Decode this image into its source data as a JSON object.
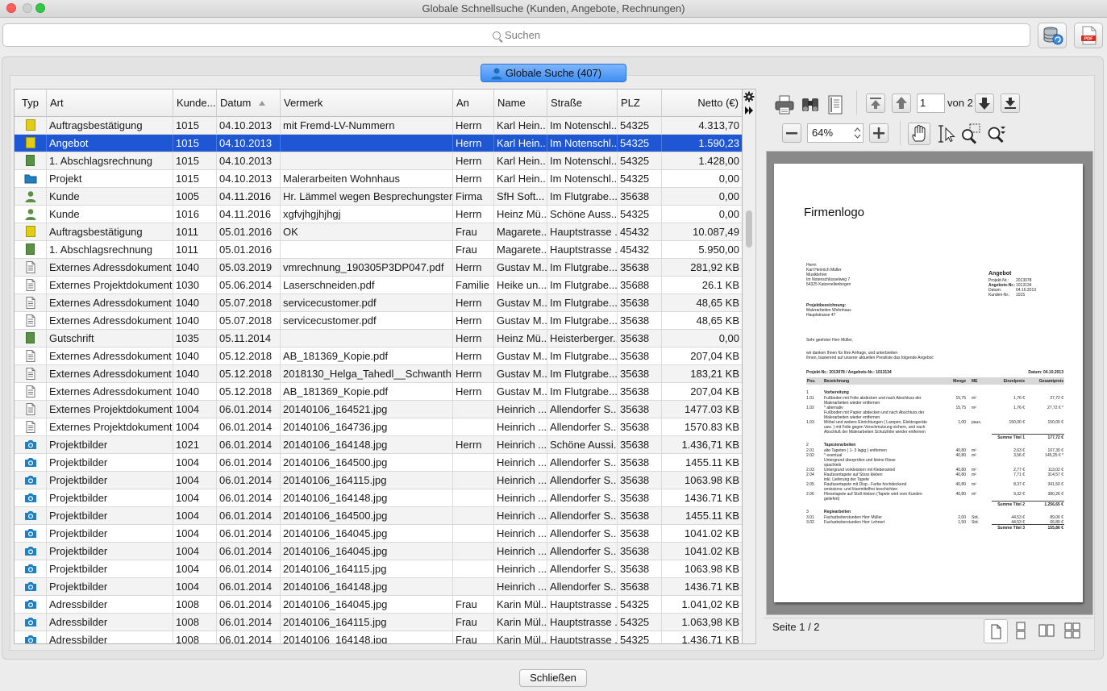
{
  "window": {
    "title": "Globale Schnellsuche (Kunden, Angebote, Rechnungen)"
  },
  "search": {
    "placeholder": "Suchen"
  },
  "toolbar": {
    "database_icon": "database-refresh-icon",
    "pdf_icon": "pdf-export-icon"
  },
  "group": {
    "label": "Globale Suche (407)"
  },
  "table": {
    "columns": [
      {
        "key": "typ",
        "label": "Typ"
      },
      {
        "key": "art",
        "label": "Art"
      },
      {
        "key": "kunde",
        "label": "Kunde..."
      },
      {
        "key": "datum",
        "label": "Datum"
      },
      {
        "key": "vermerk",
        "label": "Vermerk"
      },
      {
        "key": "an",
        "label": "An"
      },
      {
        "key": "name",
        "label": "Name"
      },
      {
        "key": "strasse",
        "label": "Straße"
      },
      {
        "key": "plz",
        "label": "PLZ"
      },
      {
        "key": "netto",
        "label": "Netto (€)"
      }
    ],
    "sort_column": "datum",
    "sort_direction": "ascending",
    "selected_row": 1,
    "rows": [
      {
        "icon": "yellow-doc",
        "art": "Auftragsbestätigung",
        "kunde": "1015",
        "datum": "04.10.2013",
        "vermerk": "mit Fremd-LV-Nummern",
        "an": "Herrn",
        "name": "Karl Hein...",
        "strasse": "Im Notenschl...",
        "plz": "54325",
        "netto": "4.313,70"
      },
      {
        "icon": "yellow-doc",
        "art": "Angebot",
        "kunde": "1015",
        "datum": "04.10.2013",
        "vermerk": "",
        "an": "Herrn",
        "name": "Karl Hein...",
        "strasse": "Im Notenschl...",
        "plz": "54325",
        "netto": "1.590,23"
      },
      {
        "icon": "green-doc",
        "art": "1. Abschlagsrechnung",
        "kunde": "1015",
        "datum": "04.10.2013",
        "vermerk": "",
        "an": "Herrn",
        "name": "Karl Hein...",
        "strasse": "Im Notenschl...",
        "plz": "54325",
        "netto": "1.428,00"
      },
      {
        "icon": "folder",
        "art": "Projekt",
        "kunde": "1015",
        "datum": "04.10.2013",
        "vermerk": "Malerarbeiten Wohnhaus",
        "an": "Herrn",
        "name": "Karl Hein...",
        "strasse": "Im Notenschl...",
        "plz": "54325",
        "netto": "0,00"
      },
      {
        "icon": "person",
        "art": "Kunde",
        "kunde": "1005",
        "datum": "04.11.2016",
        "vermerk": "Hr. Lämmel wegen Besprechungster...",
        "an": "Firma",
        "name": "SfH Soft...",
        "strasse": "Im Flutgrabe...",
        "plz": "35638",
        "netto": "0,00"
      },
      {
        "icon": "person",
        "art": "Kunde",
        "kunde": "1016",
        "datum": "04.11.2016",
        "vermerk": "xgfvjhgjhjhgj",
        "an": "Herrn",
        "name": "Heinz Mü...",
        "strasse": "Schöne Auss...",
        "plz": "54325",
        "netto": "0,00"
      },
      {
        "icon": "yellow-doc",
        "art": "Auftragsbestätigung",
        "kunde": "1011",
        "datum": "05.01.2016",
        "vermerk": "OK",
        "an": "Frau",
        "name": "Magarete...",
        "strasse": "Hauptstrasse ...",
        "plz": "45432",
        "netto": "10.087,49"
      },
      {
        "icon": "green-doc",
        "art": "1. Abschlagsrechnung",
        "kunde": "1011",
        "datum": "05.01.2016",
        "vermerk": "",
        "an": "Frau",
        "name": "Magarete...",
        "strasse": "Hauptstrasse ...",
        "plz": "45432",
        "netto": "5.950,00"
      },
      {
        "icon": "document",
        "art": "Externes Adressdokument",
        "kunde": "1040",
        "datum": "05.03.2019",
        "vermerk": "vmrechnung_190305P3DP047.pdf",
        "an": "Herrn",
        "name": "Gustav M...",
        "strasse": "Im Flutgrabe...",
        "plz": "35638",
        "netto": "281,92 KB"
      },
      {
        "icon": "document",
        "art": "Externes Projektdokument",
        "kunde": "1030",
        "datum": "05.06.2014",
        "vermerk": "Laserschneiden.pdf",
        "an": "Familie",
        "name": "Heike un...",
        "strasse": "Im Flutgrabe...",
        "plz": "35688",
        "netto": "26.1 KB"
      },
      {
        "icon": "document",
        "art": "Externes Adressdokument",
        "kunde": "1040",
        "datum": "05.07.2018",
        "vermerk": "servicecustomer.pdf",
        "an": "Herrn",
        "name": "Gustav M...",
        "strasse": "Im Flutgrabe...",
        "plz": "35638",
        "netto": "48,65 KB"
      },
      {
        "icon": "document",
        "art": "Externes Adressdokument",
        "kunde": "1040",
        "datum": "05.07.2018",
        "vermerk": "servicecustomer.pdf",
        "an": "Herrn",
        "name": "Gustav M...",
        "strasse": "Im Flutgrabe...",
        "plz": "35638",
        "netto": "48,65 KB"
      },
      {
        "icon": "green-doc",
        "art": "Gutschrift",
        "kunde": "1035",
        "datum": "05.11.2014",
        "vermerk": "",
        "an": "Herrn",
        "name": "Heinz Mü...",
        "strasse": "Heisterberger...",
        "plz": "35638",
        "netto": "0,00"
      },
      {
        "icon": "document",
        "art": "Externes Adressdokument",
        "kunde": "1040",
        "datum": "05.12.2018",
        "vermerk": "AB_181369_Kopie.pdf",
        "an": "Herrn",
        "name": "Gustav M...",
        "strasse": "Im Flutgrabe...",
        "plz": "35638",
        "netto": "207,04 KB"
      },
      {
        "icon": "document",
        "art": "Externes Adressdokument",
        "kunde": "1040",
        "datum": "05.12.2018",
        "vermerk": "2018130_Helga_Tahedl__Schwanth...",
        "an": "Herrn",
        "name": "Gustav M...",
        "strasse": "Im Flutgrabe...",
        "plz": "35638",
        "netto": "183,21 KB"
      },
      {
        "icon": "document",
        "art": "Externes Adressdokument",
        "kunde": "1040",
        "datum": "05.12.2018",
        "vermerk": "AB_181369_Kopie.pdf",
        "an": "Herrn",
        "name": "Gustav M...",
        "strasse": "Im Flutgrabe...",
        "plz": "35638",
        "netto": "207,04 KB"
      },
      {
        "icon": "document",
        "art": "Externes Projektdokument",
        "kunde": "1004",
        "datum": "06.01.2014",
        "vermerk": "20140106_164521.jpg",
        "an": "",
        "name": "Heinrich ...",
        "strasse": "Allendorfer S...",
        "plz": "35638",
        "netto": "1477.03 KB"
      },
      {
        "icon": "document",
        "art": "Externes Projektdokument",
        "kunde": "1004",
        "datum": "06.01.2014",
        "vermerk": "20140106_164736.jpg",
        "an": "",
        "name": "Heinrich ...",
        "strasse": "Allendorfer S...",
        "plz": "35638",
        "netto": "1570.83 KB"
      },
      {
        "icon": "camera",
        "art": "Projektbilder",
        "kunde": "1021",
        "datum": "06.01.2014",
        "vermerk": "20140106_164148.jpg",
        "an": "Herrn",
        "name": "Heinrich ...",
        "strasse": "Schöne Aussi...",
        "plz": "35638",
        "netto": "1.436,71 KB"
      },
      {
        "icon": "camera",
        "art": "Projektbilder",
        "kunde": "1004",
        "datum": "06.01.2014",
        "vermerk": "20140106_164500.jpg",
        "an": "",
        "name": "Heinrich ...",
        "strasse": "Allendorfer S...",
        "plz": "35638",
        "netto": "1455.11 KB"
      },
      {
        "icon": "camera",
        "art": "Projektbilder",
        "kunde": "1004",
        "datum": "06.01.2014",
        "vermerk": "20140106_164115.jpg",
        "an": "",
        "name": "Heinrich ...",
        "strasse": "Allendorfer S...",
        "plz": "35638",
        "netto": "1063.98 KB"
      },
      {
        "icon": "camera",
        "art": "Projektbilder",
        "kunde": "1004",
        "datum": "06.01.2014",
        "vermerk": "20140106_164148.jpg",
        "an": "",
        "name": "Heinrich ...",
        "strasse": "Allendorfer S...",
        "plz": "35638",
        "netto": "1436.71 KB"
      },
      {
        "icon": "camera",
        "art": "Projektbilder",
        "kunde": "1004",
        "datum": "06.01.2014",
        "vermerk": "20140106_164500.jpg",
        "an": "",
        "name": "Heinrich ...",
        "strasse": "Allendorfer S...",
        "plz": "35638",
        "netto": "1455.11 KB"
      },
      {
        "icon": "camera",
        "art": "Projektbilder",
        "kunde": "1004",
        "datum": "06.01.2014",
        "vermerk": "20140106_164045.jpg",
        "an": "",
        "name": "Heinrich ...",
        "strasse": "Allendorfer S...",
        "plz": "35638",
        "netto": "1041.02 KB"
      },
      {
        "icon": "camera",
        "art": "Projektbilder",
        "kunde": "1004",
        "datum": "06.01.2014",
        "vermerk": "20140106_164045.jpg",
        "an": "",
        "name": "Heinrich ...",
        "strasse": "Allendorfer S...",
        "plz": "35638",
        "netto": "1041.02 KB"
      },
      {
        "icon": "camera",
        "art": "Projektbilder",
        "kunde": "1004",
        "datum": "06.01.2014",
        "vermerk": "20140106_164115.jpg",
        "an": "",
        "name": "Heinrich ...",
        "strasse": "Allendorfer S...",
        "plz": "35638",
        "netto": "1063.98 KB"
      },
      {
        "icon": "camera",
        "art": "Projektbilder",
        "kunde": "1004",
        "datum": "06.01.2014",
        "vermerk": "20140106_164148.jpg",
        "an": "",
        "name": "Heinrich ...",
        "strasse": "Allendorfer S...",
        "plz": "35638",
        "netto": "1436.71 KB"
      },
      {
        "icon": "camera",
        "art": "Adressbilder",
        "kunde": "1008",
        "datum": "06.01.2014",
        "vermerk": "20140106_164045.jpg",
        "an": "Frau",
        "name": "Karin Mül...",
        "strasse": "Hauptstrasse ...",
        "plz": "54325",
        "netto": "1.041,02 KB"
      },
      {
        "icon": "camera",
        "art": "Adressbilder",
        "kunde": "1008",
        "datum": "06.01.2014",
        "vermerk": "20140106_164115.jpg",
        "an": "Frau",
        "name": "Karin Mül...",
        "strasse": "Hauptstrasse ...",
        "plz": "54325",
        "netto": "1.063,98 KB"
      },
      {
        "icon": "camera",
        "art": "Adressbilder",
        "kunde": "1008",
        "datum": "06.01.2014",
        "vermerk": "20140106_164148.jpg",
        "an": "Frau",
        "name": "Karin Mül...",
        "strasse": "Hauptstrasse ...",
        "plz": "54325",
        "netto": "1.436,71 KB"
      }
    ]
  },
  "preview": {
    "page_input": "1",
    "page_of": "von 2",
    "zoom": "64%",
    "status": "Seite 1 / 2",
    "document": {
      "logo": "Firmenlogo",
      "addr": [
        "Herrn",
        "Karl Heinrich Müller",
        "Musiklehrer",
        "Im Notenschlüsselweg 7",
        "54325 Katzenellenbogen"
      ],
      "doc_type": "Angebot",
      "meta_labels": [
        "Projekt-Nr.:",
        "Angebots-Nr.:",
        "Datum:",
        "Kunden-Nr.:"
      ],
      "meta_values": [
        "2013078",
        "1013134",
        "04.10.2013",
        "1015"
      ],
      "project_label": "Projektbezeichnung:",
      "project_lines": [
        "Malerarbeiten Wohnhaus",
        "Hauptstrasse 47"
      ],
      "salutation": "Sehr geehrter Herr Müller,",
      "intro": [
        "wir danken Ihnen für Ihre Anfrage, und unterbreiten",
        "Ihnen, basierend auf unserer aktuellen Preisliste das folgende Angebot:"
      ],
      "ref_line": "Projekt-Nr.: 2013078 / Angebots-Nr.: 1013134",
      "ref_date": "Datum: 04.10.2013",
      "thead": [
        "Pos.",
        "Bezeichnung",
        "Menge",
        "ME",
        "Einzelpreis",
        "Gesamtpreis"
      ],
      "lines": [
        {
          "pos": "1",
          "text": "Vorbereitung",
          "bold": true
        },
        {
          "pos": "1.01",
          "text": "Fußboden mit Folie abdecken und nach Abschluss der",
          "menge": "15,75",
          "me": "m²",
          "ep": "1,76 €",
          "gp": "27,72 €"
        },
        {
          "pos": "",
          "text": "Malerarbeiten wieder entfernen"
        },
        {
          "pos": "1.02",
          "text": "* alternativ",
          "menge": "15,75",
          "me": "m²",
          "ep": "1,76 €",
          "gp": "27,72 € *"
        },
        {
          "pos": "",
          "text": "Fußboden mit Papier abdecken und nach Abschluss der"
        },
        {
          "pos": "",
          "text": "Malerarbeiten wieder entfernen"
        },
        {
          "pos": "1.03",
          "text": "Möbel und weitere Einrichtungen ( Lampen, Elektrogeräte",
          "menge": "1,00",
          "me": "paus.",
          "ep": "150,00 €",
          "gp": "150,00 €"
        },
        {
          "pos": "",
          "text": "usw. ) mit Folie gegen Verschmutzung sichern, und nach"
        },
        {
          "pos": "",
          "text": "Abschluß der Malerarbeiten Schutzfolie wieder entfernen"
        },
        {
          "pos": "",
          "text": "",
          "sum": "Summe Titel 1",
          "gp": "177,72 €"
        },
        {
          "pos": "2",
          "text": "Tapezierarbeiten",
          "bold": true
        },
        {
          "pos": "2.01",
          "text": "alte Tapeten ( 1- 3 lagig ) entfernen",
          "menge": "40,80",
          "me": "m²",
          "ep": "2,63 €",
          "gp": "107,30 €"
        },
        {
          "pos": "2.02",
          "text": "* eventual",
          "menge": "40,80",
          "me": "m²",
          "ep": "3,56 €",
          "gp": "145,25 € *"
        },
        {
          "pos": "",
          "text": "Untergrund überprüfen und kleine Risse"
        },
        {
          "pos": "",
          "text": "spachteln"
        },
        {
          "pos": "2.03",
          "text": "Untergrund vorkleistern mit Kleberanteil",
          "menge": "40,80",
          "me": "m²",
          "ep": "2,77 €",
          "gp": "113,02 €"
        },
        {
          "pos": "2.04",
          "text": "Raufasertapete auf Stoss kleben",
          "menge": "40,80",
          "me": "m²",
          "ep": "7,71 €",
          "gp": "314,57 €"
        },
        {
          "pos": "",
          "text": "inkl. Lieferung der Tapete"
        },
        {
          "pos": "2.05",
          "text": "Raufasertapete mit Disp.- Farbe hochdeckend",
          "menge": "40,80",
          "me": "m²",
          "ep": "8,37 €",
          "gp": "341,50 €"
        },
        {
          "pos": "",
          "text": "emissions- und lösemittelfrei beschichten"
        },
        {
          "pos": "2.06",
          "text": "Fliesetapete auf Stoß kleben (Tapete wird vom Kunden",
          "menge": "40,80",
          "me": "m²",
          "ep": "9,32 €",
          "gp": "380,26 €"
        },
        {
          "pos": "",
          "text": "geliefert)"
        },
        {
          "pos": "",
          "text": "",
          "sum": "Summe Titel 2",
          "gp": "1.256,65 €"
        },
        {
          "pos": "3",
          "text": "Regiearbeiten",
          "bold": true
        },
        {
          "pos": "3.01",
          "text": "Facharbeiterstunden Herr Müller",
          "menge": "2,00",
          "me": "Std.",
          "ep": "44,53 €",
          "gp": "89,06 €"
        },
        {
          "pos": "3.02",
          "text": "Facharbeiterstunden Herr Lehnert",
          "menge": "1,50",
          "me": "Std.",
          "ep": "44,53 €",
          "gp": "66,80 €"
        },
        {
          "pos": "",
          "text": "",
          "sum": "Summe Titel 3",
          "gp": "155,86 €"
        }
      ]
    }
  },
  "footer": {
    "close_label": "Schließen"
  },
  "colors": {
    "selection": "#1e56d3",
    "group_header": "#3f8ef4",
    "icon_yellow": "#e2cd16",
    "icon_green": "#5a9147",
    "icon_blue": "#1f7fc3"
  }
}
